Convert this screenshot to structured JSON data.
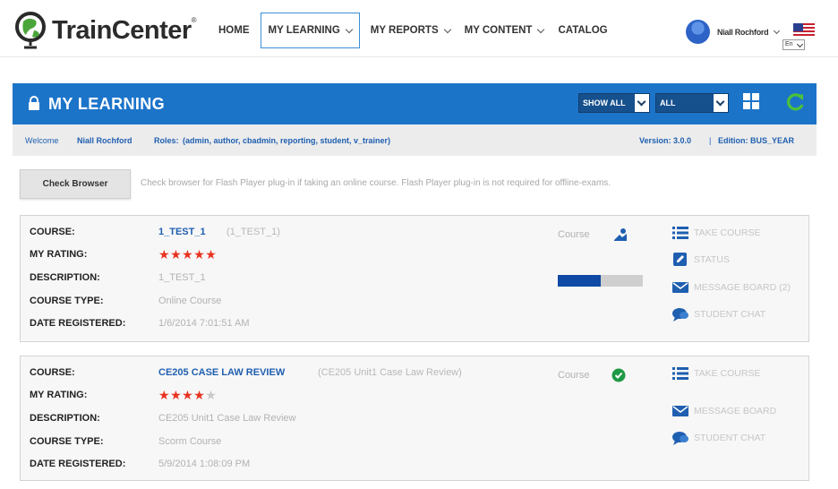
{
  "brand": {
    "name": "TrainCenter",
    "reg": "®"
  },
  "nav": [
    {
      "label": "HOME",
      "dropdown": false
    },
    {
      "label": "MY LEARNING",
      "dropdown": true,
      "active": true
    },
    {
      "label": "MY REPORTS",
      "dropdown": true
    },
    {
      "label": "MY CONTENT",
      "dropdown": true
    },
    {
      "label": "CATALOG",
      "dropdown": false
    }
  ],
  "user": {
    "name": "Niall Rochford",
    "language": "En"
  },
  "section": {
    "title": "MY LEARNING",
    "show_filter": "SHOW ALL",
    "status_filter": "ALL",
    "grid_icon": "grid-icon",
    "refresh_icon": "refresh-icon"
  },
  "welcome": {
    "greeting": "Welcome",
    "user": "Niall Rochford",
    "roles_label": "Roles:",
    "roles": "(admin, author, cbadmin, reporting, student, v_trainer)",
    "version": "Version: 3.0.0",
    "separator": "|",
    "edition": "Edition: BUS_YEAR"
  },
  "check_browser": {
    "button": "Check Browser",
    "message": "Check browser for Flash Player plug-in if taking an online course. Flash Player plug-in is not required for offline-exams."
  },
  "labels": {
    "course": "COURSE:",
    "rating": "MY RATING:",
    "description": "DESCRIPTION:",
    "type": "COURSE TYPE:",
    "date": "DATE REGISTERED:"
  },
  "courses": [
    {
      "name": "1_TEST_1",
      "code": "(1_TEST_1)",
      "rating": 5,
      "description": "1_TEST_1",
      "type": "Online Course",
      "date": "1/6/2014 7:01:51 AM",
      "status_label": "Course",
      "status_icon": "in-progress-icon",
      "progress": 0.5,
      "actions": [
        "TAKE COURSE",
        "STATUS",
        "MESSAGE BOARD (2)",
        "STUDENT CHAT"
      ]
    },
    {
      "name": "CE205 CASE LAW REVIEW",
      "code": "(CE205 Unit1 Case Law Review)",
      "rating": 4,
      "description": "CE205 Unit1 Case Law Review",
      "type": "Scorm Course",
      "date": "5/9/2014 1:08:09 PM",
      "status_label": "Course",
      "status_icon": "completed-check-icon",
      "actions": [
        "TAKE COURSE",
        "MESSAGE BOARD",
        "STUDENT CHAT"
      ]
    }
  ],
  "colors": {
    "accent": "#1c74c9",
    "link": "#1f5fb0",
    "star": "#e8321f",
    "check": "#1e9a45"
  }
}
